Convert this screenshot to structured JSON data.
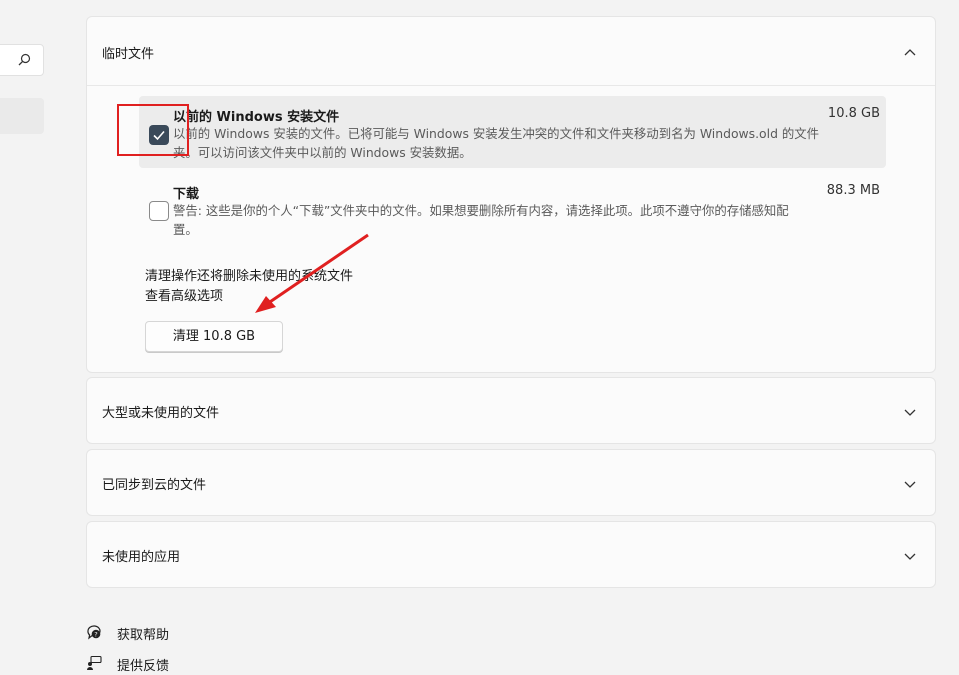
{
  "left_nav": {
    "search_icon": "search-icon"
  },
  "temp_files": {
    "title": "临时文件",
    "expanded": true,
    "items": [
      {
        "name": "以前的 Windows 安装文件",
        "size": "10.8 GB",
        "checked": true,
        "desc_line1": "以前的 Windows 安装的文件。已将可能与 Windows 安装发生冲突的文件和文件夹移动到名为 Windows.old 的文件",
        "desc_line2": "夹。可以访问该文件夹中以前的 Windows 安装数据。"
      },
      {
        "name": "下载",
        "size": "88.3 MB",
        "checked": false,
        "desc_line1": "警告: 这些是你的个人“下载”文件夹中的文件。如果想要删除所有内容，请选择此项。此项不遵守你的存储感知配",
        "desc_line2": "置。"
      }
    ],
    "note": "清理操作还将删除未使用的系统文件",
    "advanced_link": "查看高级选项",
    "clean_button": "清理 10.8 GB"
  },
  "sections": [
    {
      "title": "大型或未使用的文件"
    },
    {
      "title": "已同步到云的文件"
    },
    {
      "title": "未使用的应用"
    }
  ],
  "footer": {
    "help": "获取帮助",
    "feedback": "提供反馈"
  },
  "colors": {
    "checkbox_on": "#3a4a5a",
    "annotation": "#e02020"
  }
}
